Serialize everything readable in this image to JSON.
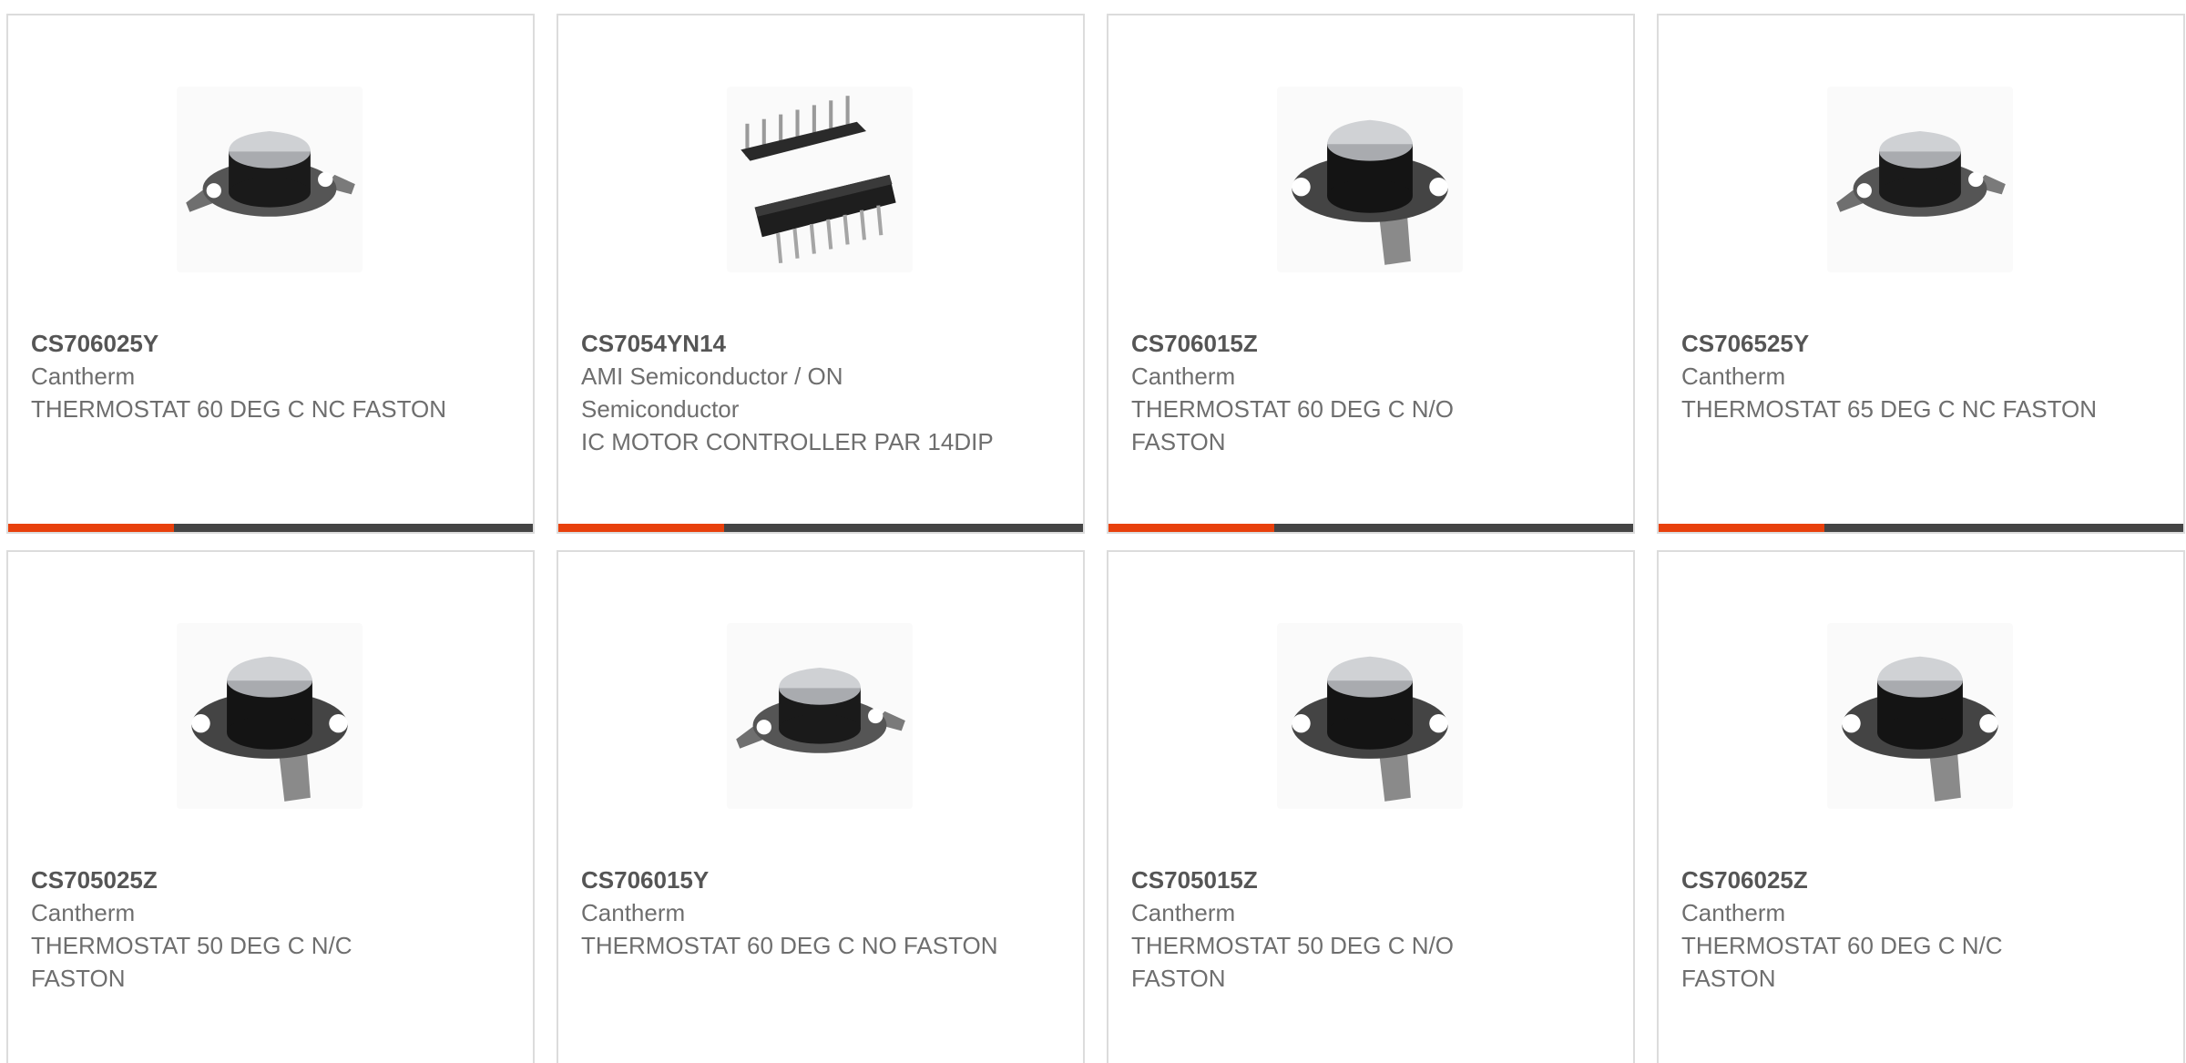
{
  "colors": {
    "accent": "#e8400c",
    "bar": "#444444",
    "border": "#dcdcdc"
  },
  "products": [
    {
      "part_number": "CS706025Y",
      "manufacturer": "Cantherm",
      "description": "THERMOSTAT 60 DEG C NC FASTON",
      "image": "thermostat-side-tabs-icon"
    },
    {
      "part_number": "CS7054YN14",
      "manufacturer": "AMI Semiconductor / ON Semiconductor",
      "description": "IC MOTOR CONTROLLER PAR 14DIP",
      "image": "dip-ic-chip-icon"
    },
    {
      "part_number": "CS706015Z",
      "manufacturer": "Cantherm",
      "description": "THERMOSTAT 60 DEG C N/O FASTON",
      "image": "thermostat-faston-tab-icon"
    },
    {
      "part_number": "CS706525Y",
      "manufacturer": "Cantherm",
      "description": "THERMOSTAT 65 DEG C NC FASTON",
      "image": "thermostat-side-tabs-icon"
    },
    {
      "part_number": "CS705025Z",
      "manufacturer": "Cantherm",
      "description": "THERMOSTAT 50 DEG C N/C FASTON",
      "image": "thermostat-faston-tab-icon"
    },
    {
      "part_number": "CS706015Y",
      "manufacturer": "Cantherm",
      "description": "THERMOSTAT 60 DEG C NO FASTON",
      "image": "thermostat-side-tabs-icon"
    },
    {
      "part_number": "CS705015Z",
      "manufacturer": "Cantherm",
      "description": "THERMOSTAT 50 DEG C N/O FASTON",
      "image": "thermostat-faston-tab-icon"
    },
    {
      "part_number": "CS706025Z",
      "manufacturer": "Cantherm",
      "description": "THERMOSTAT 60 DEG C N/C FASTON",
      "image": "thermostat-faston-tab-icon"
    }
  ]
}
